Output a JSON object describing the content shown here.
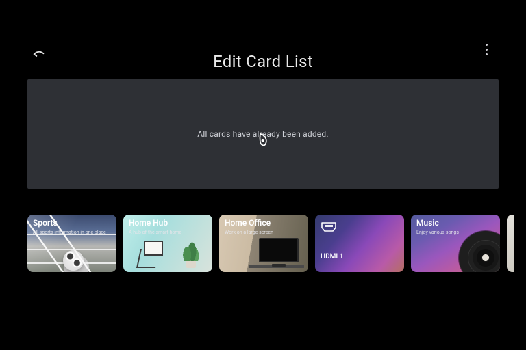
{
  "header": {
    "title": "Edit Card List"
  },
  "panel": {
    "empty_message": "All cards have already been added."
  },
  "cards": [
    {
      "title": "Sports",
      "subtitle": "All sports information in one place"
    },
    {
      "title": "Home Hub",
      "subtitle": "A hub of the smart home"
    },
    {
      "title": "Home Office",
      "subtitle": "Work on a large screen"
    },
    {
      "title": "HDMI 1",
      "subtitle": ""
    },
    {
      "title": "Music",
      "subtitle": "Enjoy various songs"
    }
  ],
  "icons": {
    "back": "back-icon",
    "more": "more-icon",
    "hdmi": "hdmi-icon",
    "cursor": "pointer-cursor-icon"
  }
}
